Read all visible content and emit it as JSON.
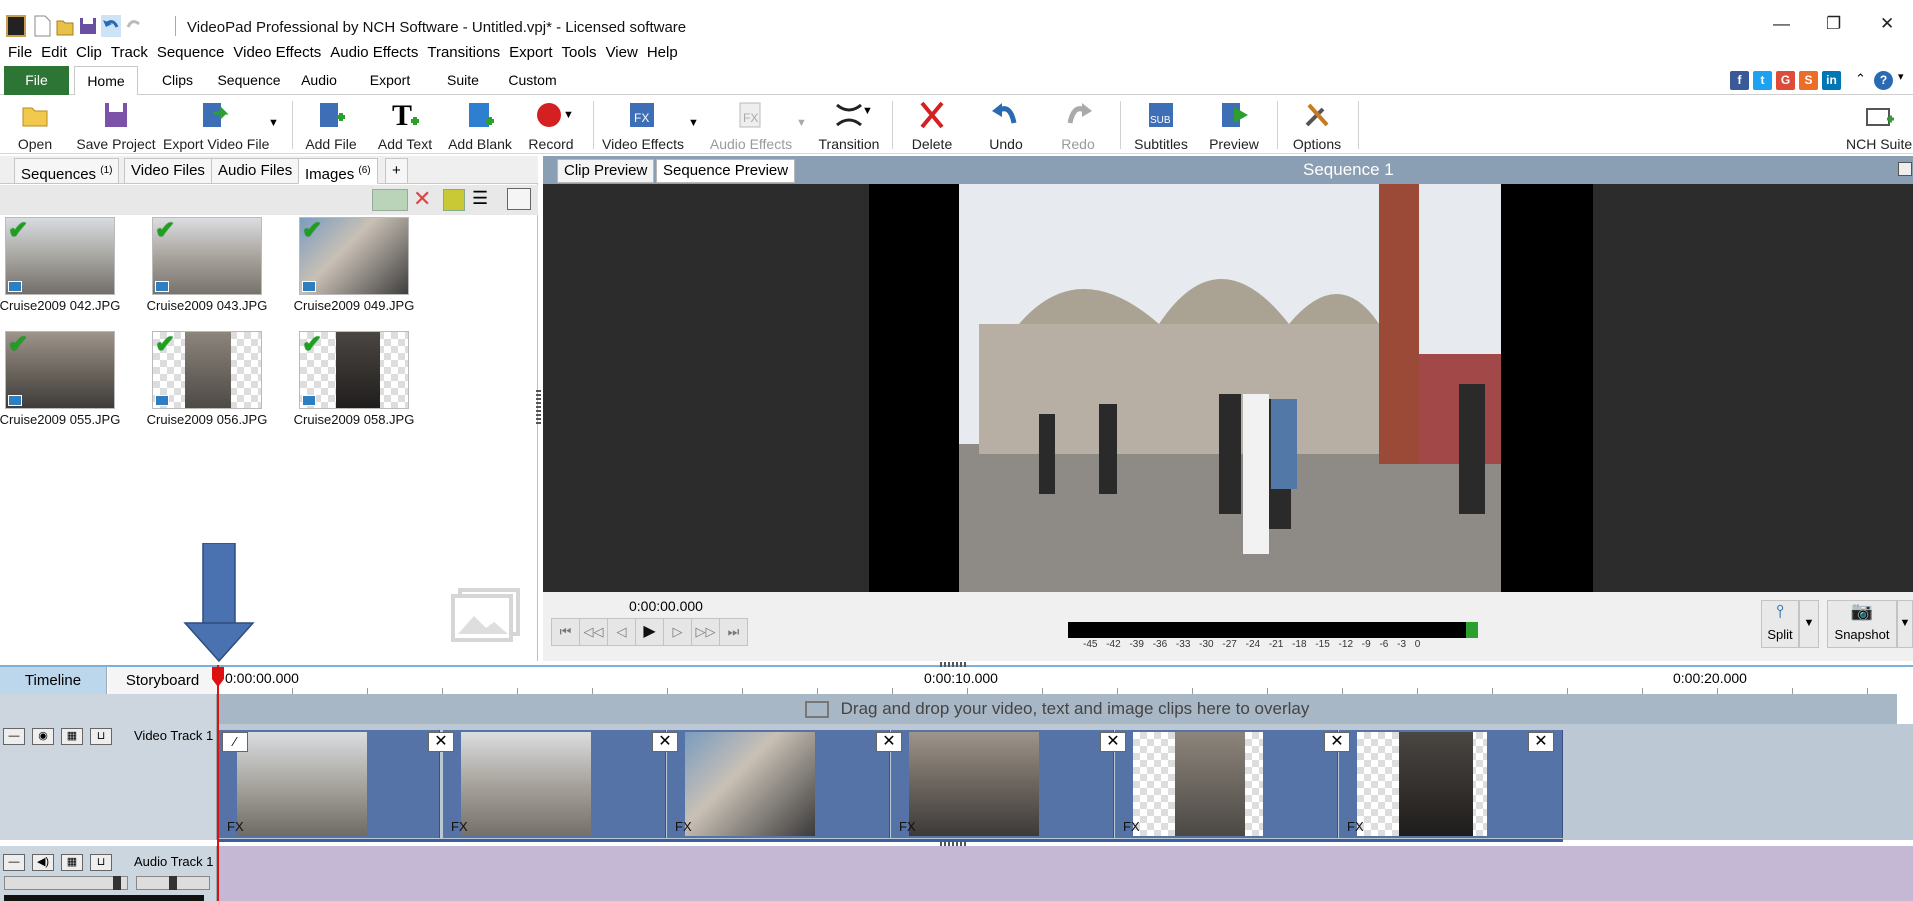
{
  "window": {
    "title": "VideoPad Professional by NCH Software - Untitled.vpj* - Licensed software",
    "minimize": "—",
    "restore": "❐",
    "close": "✕"
  },
  "menu": [
    "File",
    "Edit",
    "Clip",
    "Track",
    "Sequence",
    "Video Effects",
    "Audio Effects",
    "Transitions",
    "Export",
    "Tools",
    "View",
    "Help"
  ],
  "ribbon_tabs": [
    "File",
    "Home",
    "Clips",
    "Sequence",
    "Audio",
    "Export",
    "Suite",
    "Custom"
  ],
  "social": {
    "fb": "f",
    "tw": "t",
    "gp": "G",
    "su": "S",
    "li": "in",
    "help": "?"
  },
  "toolbar": {
    "open": "Open",
    "save_project": "Save Project",
    "export_video": "Export Video File",
    "add_file": "Add File",
    "add_text": "Add Text",
    "add_blank": "Add Blank",
    "record": "Record",
    "video_effects": "Video Effects",
    "audio_effects": "Audio Effects",
    "transition": "Transition",
    "delete": "Delete",
    "undo": "Undo",
    "redo": "Redo",
    "subtitles": "Subtitles",
    "preview": "Preview",
    "options": "Options",
    "nch_suite": "NCH Suite"
  },
  "bins": {
    "tabs": [
      {
        "label": "Sequences",
        "count": "(1)"
      },
      {
        "label": "Video Files",
        "count": ""
      },
      {
        "label": "Audio Files",
        "count": ""
      },
      {
        "label": "Images",
        "count": "(6)"
      }
    ],
    "add_tab": "+",
    "images": [
      "Cruise2009 042.JPG",
      "Cruise2009 043.JPG",
      "Cruise2009 049.JPG",
      "Cruise2009 055.JPG",
      "Cruise2009 056.JPG",
      "Cruise2009 058.JPG"
    ]
  },
  "preview": {
    "tabs": [
      "Clip Preview",
      "Sequence Preview"
    ],
    "title": "Sequence 1",
    "timecode": "0:00:00.000",
    "meter_scale": "-45 -42 -39 -36 -33 -30 -27 -24 -21 -18 -15 -12 -9 -6 -3 0",
    "split": "Split",
    "snapshot": "Snapshot"
  },
  "timeline": {
    "tabs": [
      "Timeline",
      "Storyboard"
    ],
    "marks": [
      "0:00:00.000",
      "0:00:10.000",
      "0:00:20.000"
    ],
    "overlay_hint": "Drag and drop your video, text and image clips here to overlay",
    "video_track": "Video Track 1",
    "audio_track": "Audio Track 1",
    "fx_label": "FX"
  },
  "colors": {
    "file_tab": "#2c7534",
    "preview_header": "#8a9fb4",
    "video_track_bg": "#bcc8d3",
    "audio_track_bg": "#c4b8d4",
    "clip_bg": "#5673a8",
    "playhead": "#dd1111",
    "annotation_arrow": "#4a72b0"
  }
}
